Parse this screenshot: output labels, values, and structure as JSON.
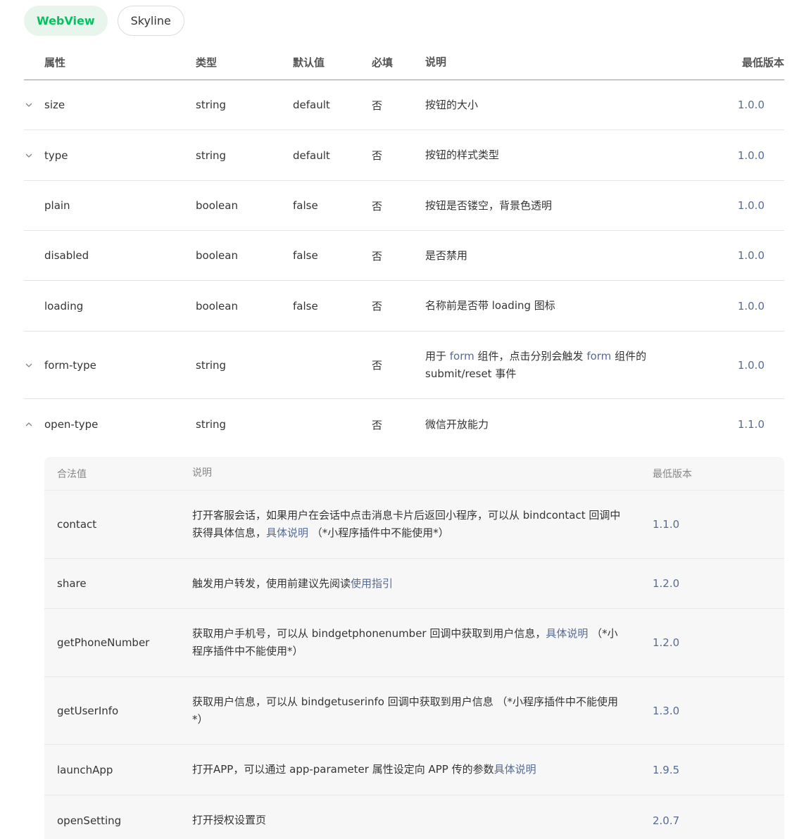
{
  "tabs": [
    {
      "label": "WebView",
      "active": true
    },
    {
      "label": "Skyline",
      "active": false
    }
  ],
  "colors": {
    "accent": "#07c160",
    "link": "#576b95",
    "text": "#353535"
  },
  "table": {
    "headers": {
      "name": "属性",
      "type": "类型",
      "default": "默认值",
      "required": "必填",
      "desc": "说明",
      "version": "最低版本"
    },
    "rows": [
      {
        "name": "size",
        "type": "string",
        "default": "default",
        "required": "否",
        "desc": "按钮的大小",
        "version": "1.0.0",
        "chevron": "chevron-down-icon"
      },
      {
        "name": "type",
        "type": "string",
        "default": "default",
        "required": "否",
        "desc": "按钮的样式类型",
        "version": "1.0.0",
        "chevron": "chevron-down-icon"
      },
      {
        "name": "plain",
        "type": "boolean",
        "default": "false",
        "required": "否",
        "desc": "按钮是否镂空，背景色透明",
        "version": "1.0.0"
      },
      {
        "name": "disabled",
        "type": "boolean",
        "default": "false",
        "required": "否",
        "desc": "是否禁用",
        "version": "1.0.0"
      },
      {
        "name": "loading",
        "type": "boolean",
        "default": "false",
        "required": "否",
        "desc": "名称前是否带 loading 图标",
        "version": "1.0.0"
      },
      {
        "name": "form-type",
        "type": "string",
        "default": "",
        "required": "否",
        "desc_parts": [
          "用于 ",
          "form",
          " 组件，点击分别会触发 ",
          "form",
          " 组件的 submit/reset 事件"
        ],
        "version": "1.0.0",
        "chevron": "chevron-down-icon"
      },
      {
        "name": "open-type",
        "type": "string",
        "default": "",
        "required": "否",
        "desc": "微信开放能力",
        "version": "1.1.0",
        "chevron": "chevron-up-icon"
      }
    ]
  },
  "subtable": {
    "headers": {
      "value": "合法值",
      "desc": "说明",
      "version": "最低版本"
    },
    "rows": [
      {
        "value": "contact",
        "desc_text": "打开客服会话，如果用户在会话中点击消息卡片后返回小程序，可以从 bindcontact 回调中获得具体信息，",
        "link": "具体说明",
        "desc_after": " （*小程序插件中不能使用*）",
        "version": "1.1.0"
      },
      {
        "value": "share",
        "desc_text": "触发用户转发，使用前建议先阅读",
        "link": "使用指引",
        "desc_after": "",
        "version": "1.2.0"
      },
      {
        "value": "getPhoneNumber",
        "desc_text": "获取用户手机号，可以从 bindgetphonenumber 回调中获取到用户信息，",
        "link": "具体说明",
        "desc_after": " （*小程序插件中不能使用*）",
        "version": "1.2.0"
      },
      {
        "value": "getUserInfo",
        "desc_text": "获取用户信息，可以从 bindgetuserinfo 回调中获取到用户信息 （*小程序插件中不能使用*）",
        "link": "",
        "desc_after": "",
        "version": "1.3.0"
      },
      {
        "value": "launchApp",
        "desc_text": "打开APP，可以通过 app-parameter 属性设定向 APP 传的参数",
        "link": "具体说明",
        "desc_after": "",
        "version": "1.9.5"
      },
      {
        "value": "openSetting",
        "desc_text": "打开授权设置页",
        "link": "",
        "desc_after": "",
        "version": "2.0.7"
      }
    ]
  }
}
